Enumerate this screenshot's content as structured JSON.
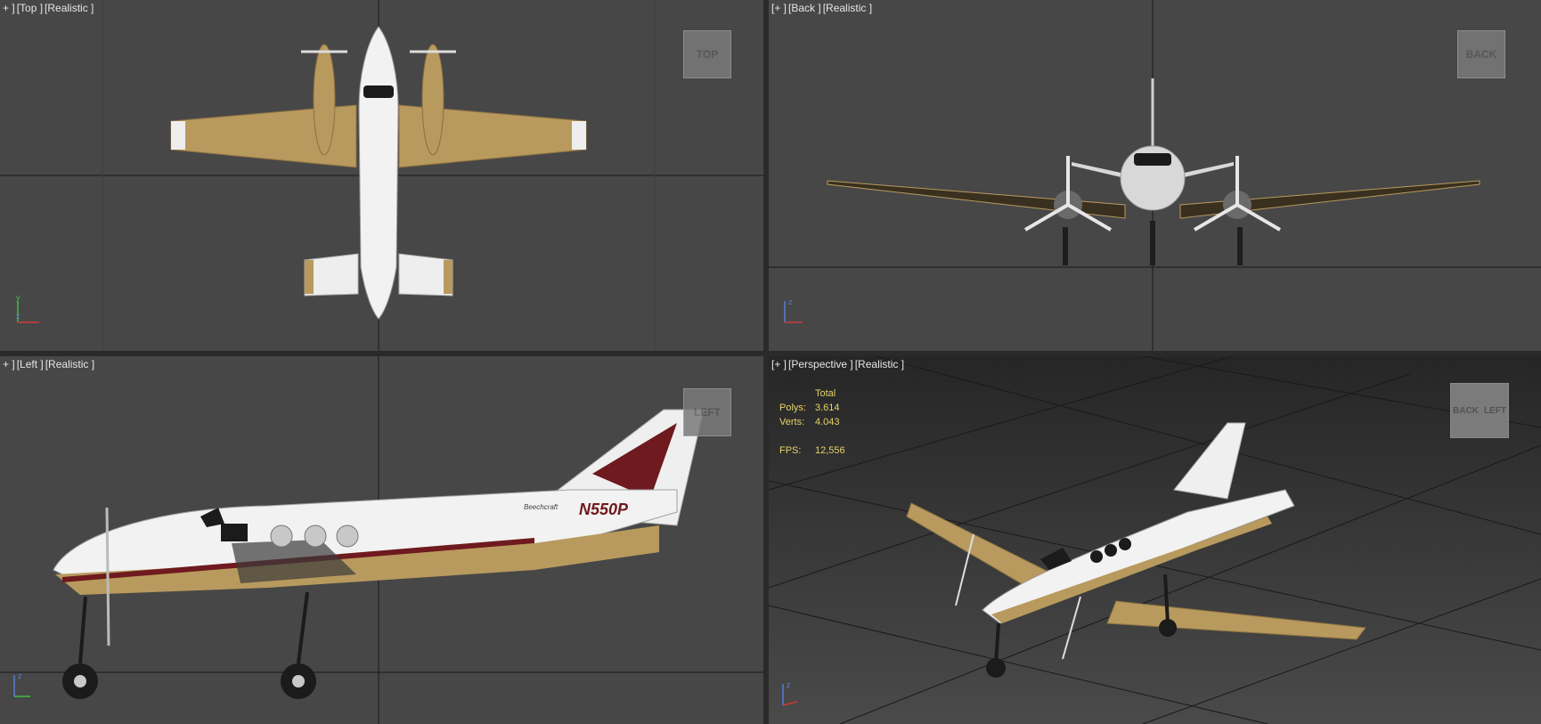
{
  "viewports": {
    "top": {
      "plus": "+ ]",
      "view": "[Top ]",
      "shading": "[Realistic ]",
      "cube": "TOP"
    },
    "back": {
      "plus": "[+ ]",
      "view": "[Back ]",
      "shading": "[Realistic ]",
      "cube": "BACK"
    },
    "left": {
      "plus": "+ ]",
      "view": "[Left ]",
      "shading": "[Realistic ]",
      "cube": "LEFT"
    },
    "perspective": {
      "plus": "[+ ]",
      "view": "[Perspective ]",
      "shading": "[Realistic ]",
      "cube_back": "BACK",
      "cube_left": "LEFT"
    }
  },
  "stats": {
    "header": "Total",
    "polys_label": "Polys:",
    "polys_value": "3.614",
    "verts_label": "Verts:",
    "verts_value": "4.043",
    "fps_label": "FPS:",
    "fps_value": "12,556"
  },
  "aircraft": {
    "registration": "N550P",
    "maker": "Beechcraft"
  },
  "axes": {
    "x": "x",
    "y": "y",
    "z": "z"
  },
  "colors": {
    "viewport_bg": "#474747",
    "active_border": "#b8a35a",
    "stats_text": "#e8d36a",
    "fuselage": "#f2f2f2",
    "wing_tan": "#b89a5e",
    "stripe": "#6e1a1e"
  }
}
